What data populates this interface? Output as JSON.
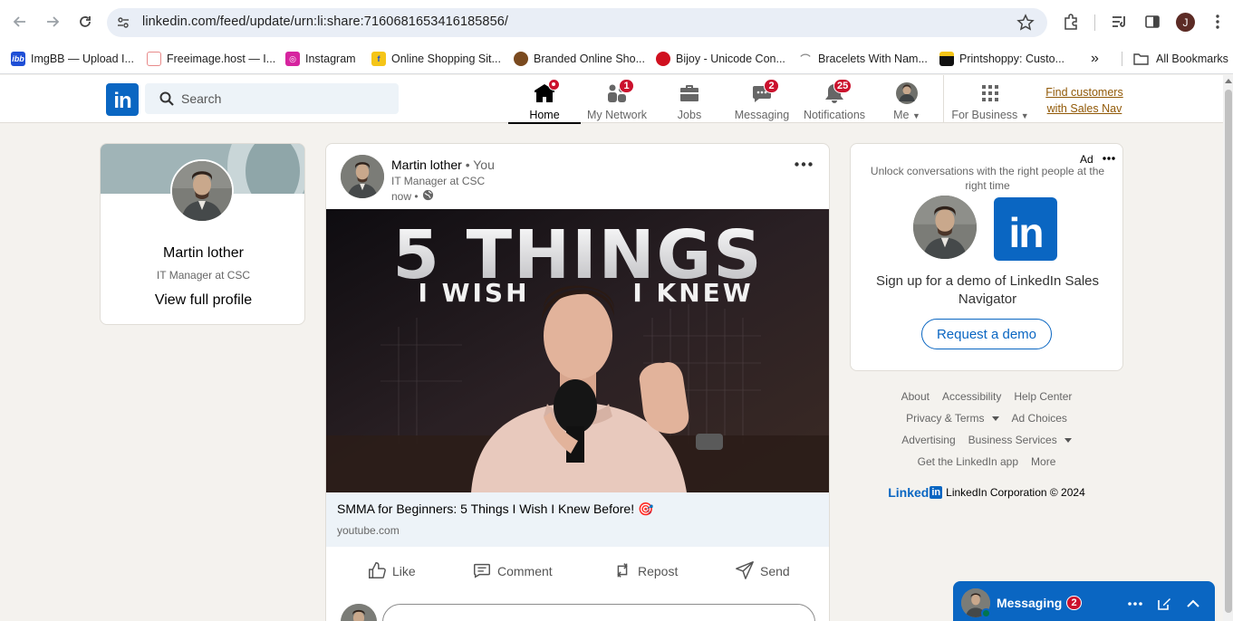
{
  "browser": {
    "url": "linkedin.com/feed/update/urn:li:share:7160681653416185856/",
    "profile_initial": "J",
    "bookmarks": [
      {
        "label": "ImgBB — Upload I...",
        "icon": "imgbb-icon",
        "color": "#1f4fd6"
      },
      {
        "label": "Freeimage.host — I...",
        "icon": "freeimage-icon",
        "color": "#e88a8a"
      },
      {
        "label": "Instagram",
        "icon": "instagram-icon",
        "color": "#d6249f"
      },
      {
        "label": "Online Shopping Sit...",
        "icon": "flipkart-icon",
        "color": "#f5c518"
      },
      {
        "label": "Branded Online Sho...",
        "icon": "shop-icon",
        "color": "#7a4a1f"
      },
      {
        "label": "Bijoy - Unicode Con...",
        "icon": "bijoy-icon",
        "color": "#d0101f"
      },
      {
        "label": "Bracelets With Nam...",
        "icon": "bracelet-icon",
        "color": "#888888"
      },
      {
        "label": "Printshoppy: Custo...",
        "icon": "printshoppy-icon",
        "color": "#111111"
      }
    ],
    "all_bookmarks_label": "All Bookmarks"
  },
  "linkedin": {
    "logo_text": "in",
    "search_placeholder": "Search",
    "nav": [
      {
        "label": "Home",
        "icon": "home-icon",
        "badge": "dot"
      },
      {
        "label": "My Network",
        "icon": "network-icon",
        "badge": "1"
      },
      {
        "label": "Jobs",
        "icon": "briefcase-icon",
        "badge": ""
      },
      {
        "label": "Messaging",
        "icon": "messaging-icon",
        "badge": "2"
      },
      {
        "label": "Notifications",
        "icon": "bell-icon",
        "badge": "25"
      },
      {
        "label": "Me",
        "icon": "avatar",
        "badge": ""
      },
      {
        "label": "For Business",
        "icon": "grid-icon",
        "badge": ""
      }
    ],
    "promo_line1": "Find customers",
    "promo_line2": "with Sales Nav"
  },
  "profile": {
    "name": "Martin lother",
    "title": "IT Manager at CSC",
    "view_link": "View full profile"
  },
  "post": {
    "author": "Martin lother",
    "you_tag": "• You",
    "headline": "IT Manager at CSC",
    "time": "now •",
    "thumbnail_line1": "5 THINGS",
    "thumbnail_line2": "I WISH",
    "thumbnail_line3": "I KNEW",
    "link_title": "SMMA for Beginners: 5 Things I Wish I Knew Before! 🎯",
    "link_domain": "youtube.com",
    "actions": {
      "like": "Like",
      "comment": "Comment",
      "repost": "Repost",
      "send": "Send"
    }
  },
  "ad": {
    "label": "Ad",
    "text": "Unlock conversations with the right people at the right time",
    "logo_text": "in",
    "headline": "Sign up for a demo of LinkedIn Sales Navigator",
    "button": "Request a demo"
  },
  "footer": {
    "about": "About",
    "accessibility": "Accessibility",
    "help": "Help Center",
    "privacy": "Privacy & Terms",
    "ad_choices": "Ad Choices",
    "advertising": "Advertising",
    "business": "Business Services",
    "app": "Get the LinkedIn app",
    "more": "More",
    "brand_word": "Linked",
    "brand_in": "in",
    "copyright": "LinkedIn Corporation © 2024"
  },
  "messaging_dock": {
    "title": "Messaging",
    "badge": "2"
  },
  "colors": {
    "linkedin_blue": "#0a66c2",
    "badge_red": "#cb112d",
    "page_bg": "#f4f2ee",
    "promo_gold": "#915907"
  }
}
